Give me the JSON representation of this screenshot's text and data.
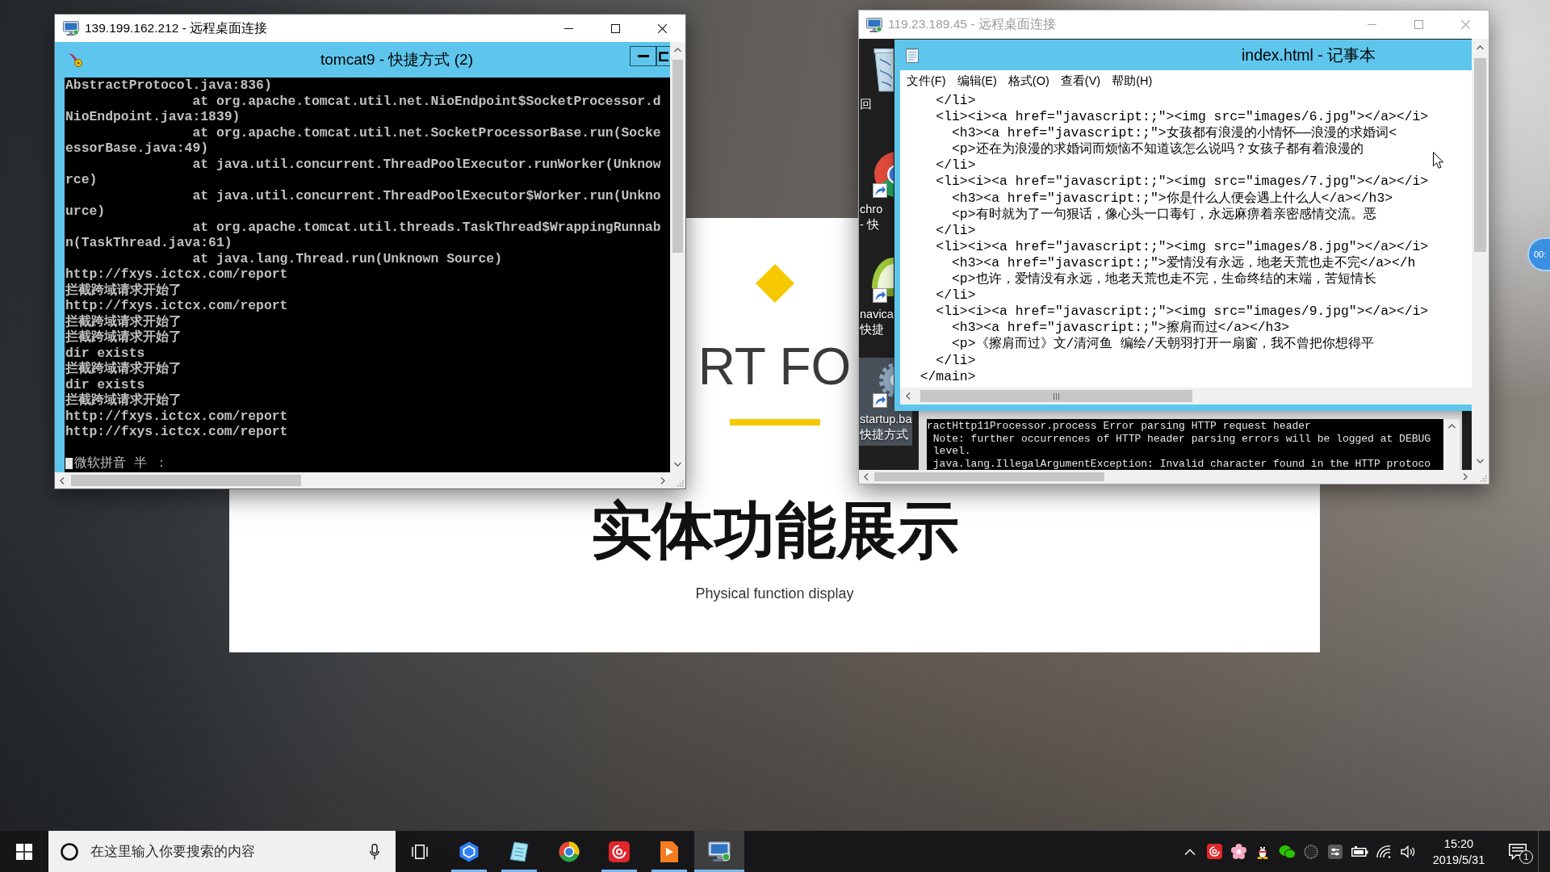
{
  "left_remote_window": {
    "title": "139.199.162.212 - 远程桌面连接",
    "active": true,
    "console": {
      "title": "tomcat9 - 快捷方式 (2)",
      "lines": [
        "AbstractProtocol.java:836)",
        "                at org.apache.tomcat.util.net.NioEndpoint$SocketProcessor.d",
        "NioEndpoint.java:1839)",
        "                at org.apache.tomcat.util.net.SocketProcessorBase.run(Socke",
        "essorBase.java:49)",
        "                at java.util.concurrent.ThreadPoolExecutor.runWorker(Unknow",
        "rce)",
        "                at java.util.concurrent.ThreadPoolExecutor$Worker.run(Unkno",
        "urce)",
        "                at org.apache.tomcat.util.threads.TaskThread$WrappingRunnab",
        "n(TaskThread.java:61)",
        "                at java.lang.Thread.run(Unknown Source)",
        "http://fxys.ictcx.com/report",
        "拦截跨域请求开始了",
        "http://fxys.ictcx.com/report",
        "拦截跨域请求开始了",
        "拦截跨域请求开始了",
        "dir exists",
        "拦截跨域请求开始了",
        "dir exists",
        "拦截跨域请求开始了",
        "http://fxys.ictcx.com/report",
        "http://fxys.ictcx.com/report"
      ],
      "ime_status": "微软拼音 半 ："
    }
  },
  "slide": {
    "section_label": "RT FO",
    "title": "实体功能展示",
    "subtitle": "Physical function display"
  },
  "right_remote_window": {
    "title": "119.23.189.45 - 远程桌面连接",
    "active": false,
    "desktop_icons": [
      {
        "kind": "trash",
        "label_lines": [
          "回"
        ],
        "selected": false
      },
      {
        "kind": "color-wheel",
        "label_lines": [
          "chro",
          "- 快"
        ],
        "selected": false
      },
      {
        "kind": "dome",
        "label_lines": [
          "navica",
          "快捷"
        ],
        "selected": false
      },
      {
        "kind": "gears",
        "label_lines": [
          "startup.ba",
          "快捷方式"
        ],
        "selected": true
      }
    ],
    "notepad": {
      "title": "index.html - 记事本",
      "menu": [
        "文件(F)",
        "编辑(E)",
        "格式(O)",
        "查看(V)",
        "帮助(H)"
      ],
      "lines": [
        "    </li>",
        "    <li><i><a href=\"javascript:;\"><img src=\"images/6.jpg\"></a></i>",
        "      <h3><a href=\"javascript:;\">女孩都有浪漫的小情怀——浪漫的求婚词<",
        "      <p>还在为浪漫的求婚词而烦恼不知道该怎么说吗？女孩子都有着浪漫的",
        "    </li>",
        "    <li><i><a href=\"javascript:;\"><img src=\"images/7.jpg\"></a></i>",
        "      <h3><a href=\"javascript:;\">你是什么人便会遇上什么人</a></h3>",
        "      <p>有时就为了一句狠话，像心头一口毒钉，永远麻痹着亲密感情交流。恶",
        "    </li>",
        "    <li><i><a href=\"javascript:;\"><img src=\"images/8.jpg\"></a></i>",
        "      <h3><a href=\"javascript:;\">爱情没有永远，地老天荒也走不完</a></h",
        "      <p>也许，爱情没有永远，地老天荒也走不完，生命终结的末端，苦短情长",
        "    </li>",
        "    <li><i><a href=\"javascript:;\"><img src=\"images/9.jpg\"></a></i>",
        "      <h3><a href=\"javascript:;\">擦肩而过</a></h3>",
        "      <p>《擦肩而过》文/清河鱼 编绘/天朝羽打开一扇窗，我不曾把你想得平",
        "    </li>",
        "  </main>"
      ]
    },
    "console": {
      "lines": [
        "ractHttp11Processor.process Error parsing HTTP request header",
        " Note: further occurrences of HTTP header parsing errors will be logged at DEBUG",
        " level.",
        " java.lang.IllegalArgumentException: Invalid character found in the HTTP protoco"
      ]
    }
  },
  "floating_timer": "00:",
  "taskbar": {
    "search": {
      "placeholder": "在这里输入你要搜索的内容"
    },
    "apps": [
      {
        "kind": "hexagon",
        "running": true,
        "selected": false
      },
      {
        "kind": "notebook",
        "running": true,
        "selected": false
      },
      {
        "kind": "color-ring",
        "running": false,
        "selected": false
      },
      {
        "kind": "swirl",
        "running": true,
        "selected": false
      },
      {
        "kind": "play",
        "running": true,
        "selected": false
      },
      {
        "kind": "monitor",
        "running": true,
        "selected": true
      }
    ],
    "time": "15:20",
    "date": "2019/5/31",
    "notification_count": "1"
  }
}
